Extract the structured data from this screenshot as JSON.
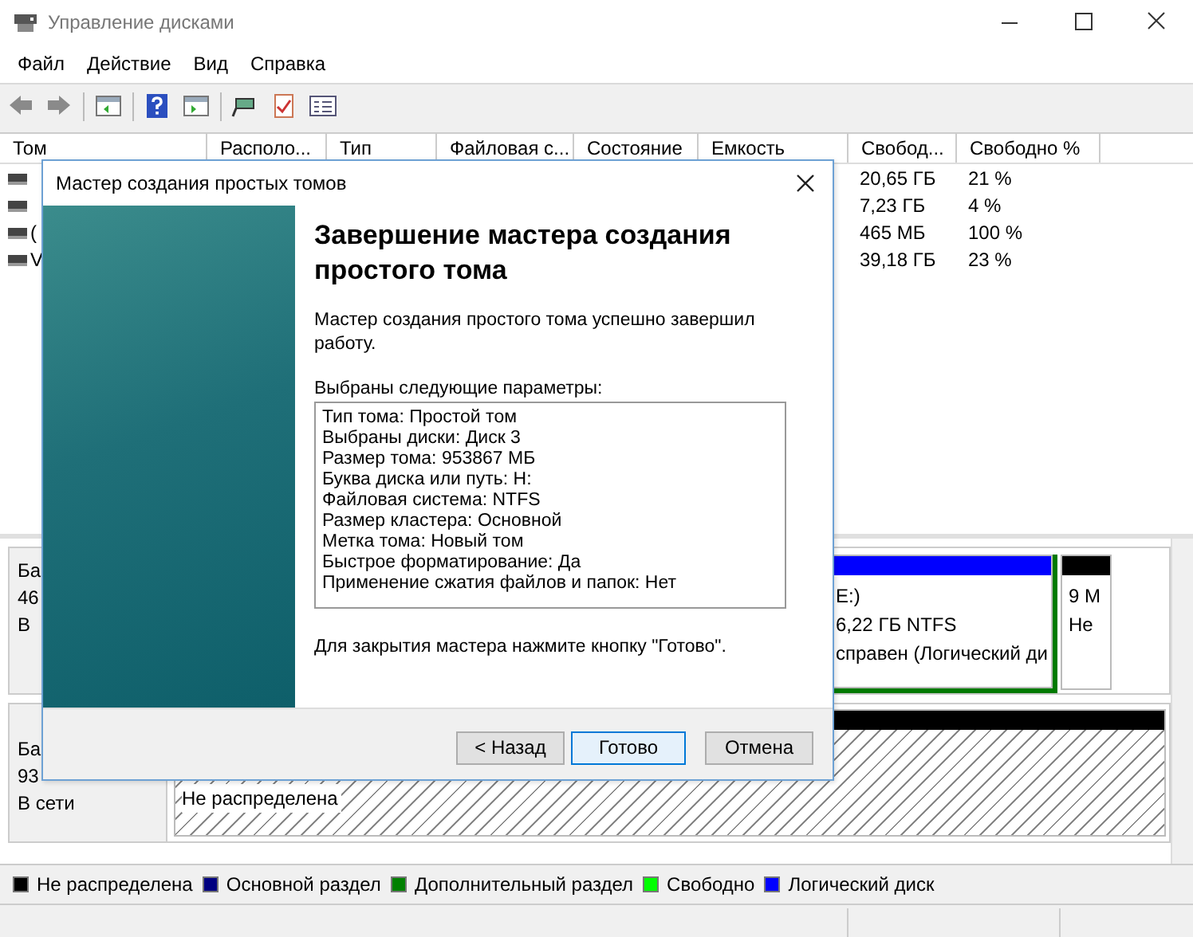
{
  "window": {
    "title": "Управление дисками"
  },
  "menu": [
    "Файл",
    "Действие",
    "Вид",
    "Справка"
  ],
  "table": {
    "columns": [
      "Том",
      "Располо...",
      "Тип",
      "Файловая с...",
      "Состояние",
      "Емкость",
      "Свобод...",
      "Свободно %"
    ],
    "rows": [
      {
        "free": "20,65 ГБ",
        "free_percent": "21 %"
      },
      {
        "free": "7,23 ГБ",
        "free_percent": "4 %"
      },
      {
        "volume": "(",
        "free": "465 МБ",
        "free_percent": "100 %"
      },
      {
        "volume": "V",
        "free": "39,18 ГБ",
        "free_percent": "23 %"
      }
    ]
  },
  "disks": [
    {
      "label_lines": [
        "Ба",
        "46",
        "В"
      ],
      "partitions": [
        {
          "kind": "logical",
          "lines": [
            "E:)",
            "6,22 ГБ NTFS",
            "справен (Логический ди"
          ]
        },
        {
          "kind": "unallocated",
          "lines": [
            "9 М",
            "Не"
          ]
        }
      ]
    },
    {
      "label_lines": [
        "Ба",
        "93",
        "В сети"
      ],
      "partitions": [
        {
          "kind": "unallocated",
          "lines": [
            "Не распределена"
          ]
        }
      ]
    }
  ],
  "legend": [
    {
      "label": "Не распределена",
      "color": "#000000"
    },
    {
      "label": "Основной раздел",
      "color": "#000080"
    },
    {
      "label": "Дополнительный раздел",
      "color": "#008000"
    },
    {
      "label": "Свободно",
      "color": "#00ff00"
    },
    {
      "label": "Логический диск",
      "color": "#0000ff"
    }
  ],
  "dialog": {
    "title": "Мастер создания простых томов",
    "heading": "Завершение мастера создания простого тома",
    "intro": "Мастер создания простого тома успешно завершил работу.",
    "params_label": "Выбраны следующие параметры:",
    "params": [
      "Тип тома: Простой том",
      "Выбраны диски: Диск 3",
      "Размер тома: 953867 МБ",
      "Буква диска или путь: H:",
      "Файловая система: NTFS",
      "Размер кластера: Основной",
      "Метка тома: Новый том",
      "Быстрое форматирование: Да",
      "Применение сжатия файлов и папок: Нет"
    ],
    "footer": "Для закрытия мастера нажмите кнопку \"Готово\".",
    "buttons": [
      {
        "label": "< Назад",
        "default": false
      },
      {
        "label": "Готово",
        "default": true
      },
      {
        "label": "Отмена",
        "default": false
      }
    ]
  }
}
